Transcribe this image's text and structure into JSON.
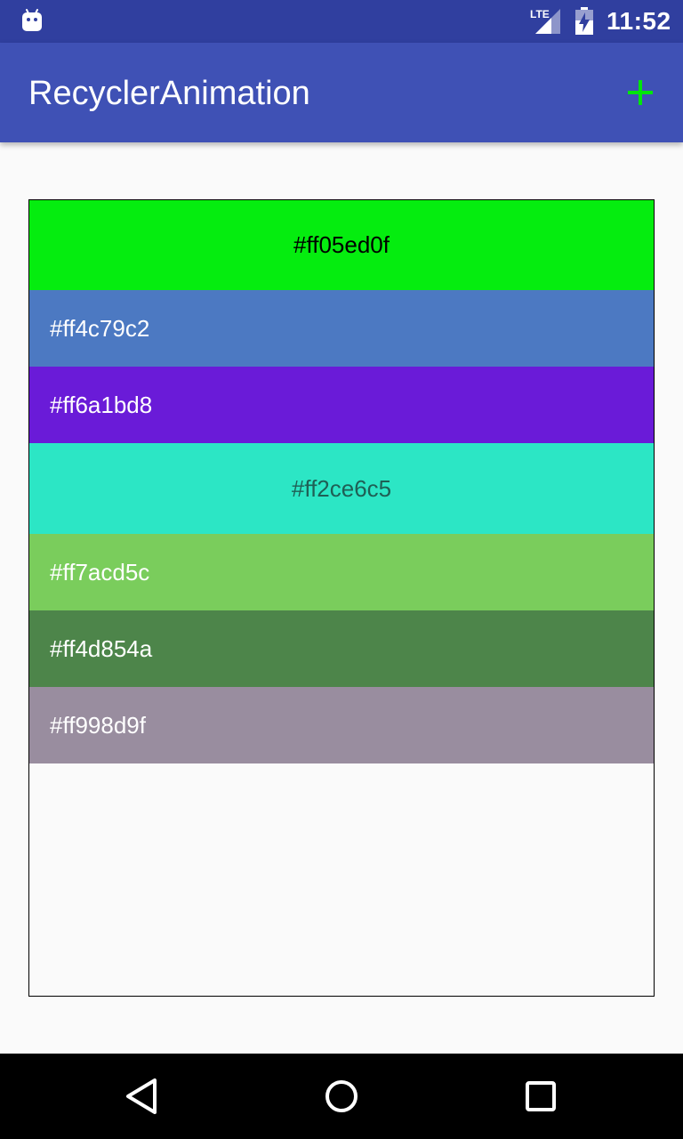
{
  "status_bar": {
    "time": "11:52",
    "network_label": "LTE",
    "icons": [
      "android-notification-icon",
      "lte-signal-icon",
      "battery-charging-icon"
    ]
  },
  "toolbar": {
    "title": "RecyclerAnimation",
    "add_icon": "plus-icon",
    "add_icon_color": "#00e60a"
  },
  "colors": {
    "status_bar": "#303f9f",
    "toolbar": "#3f51b5",
    "background": "#fafafa"
  },
  "list": {
    "items": [
      {
        "label": "#ff05ed0f",
        "color": "#05ed0f",
        "text_color": "#000000",
        "expanded": true
      },
      {
        "label": "#ff4c79c2",
        "color": "#4c79c2",
        "text_color": "#ffffff",
        "expanded": false
      },
      {
        "label": "#ff6a1bd8",
        "color": "#6a1bd8",
        "text_color": "#ffffff",
        "expanded": false
      },
      {
        "label": "#ff2ce6c5",
        "color": "#2ce6c5",
        "text_color": "#1f5f55",
        "expanded": true
      },
      {
        "label": "#ff7acd5c",
        "color": "#7acd5c",
        "text_color": "#ffffff",
        "expanded": false
      },
      {
        "label": "#ff4d854a",
        "color": "#4d854a",
        "text_color": "#ffffff",
        "expanded": false
      },
      {
        "label": "#ff998d9f",
        "color": "#998d9f",
        "text_color": "#ffffff",
        "expanded": false
      }
    ]
  },
  "nav_bar": {
    "buttons": [
      "back-icon",
      "home-icon",
      "recents-icon"
    ]
  }
}
